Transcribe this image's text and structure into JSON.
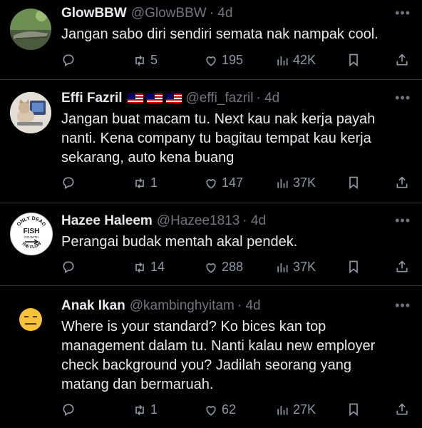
{
  "tweets": [
    {
      "name": "GlowBBW",
      "handle": "@GlowBBW",
      "time": "· 4d",
      "text": "Jangan sabo diri sendiri semata nak nampak cool.",
      "replies": "",
      "retweets": "5",
      "likes": "195",
      "views": "42K",
      "avatar_icon": "crocodile-photo-avatar"
    },
    {
      "name": "Effi Fazril",
      "handle": "@effi_fazril",
      "time": "· 4d",
      "flags": [
        "malaysia-flag",
        "malaysia-flag",
        "malaysia-flag"
      ],
      "text": "Jangan buat macam tu. Next kau nak kerja payah nanti. Kena company tu bagitau tempat kau kerja sekarang, auto kena buang",
      "replies": "",
      "retweets": "1",
      "likes": "147",
      "views": "37K",
      "avatar_icon": "cat-laptop-avatar"
    },
    {
      "name": "Hazee Haleem",
      "handle": "@Hazee1813",
      "time": "· 4d",
      "text": "Perangai budak mentah akal pendek.",
      "replies": "",
      "retweets": "14",
      "likes": "288",
      "views": "37K",
      "avatar_top": "ONLY DEAD",
      "avatar_mid": "FISH",
      "avatar_sub": "GO WITH",
      "avatar_bottom": "THE FLOW"
    },
    {
      "name": "Anak Ikan",
      "handle": "@kambinghyitam",
      "time": "· 4d",
      "text": "Where is your standard? Ko bices kan top management dalam tu. Nanti kalau new employer check background you? Jadilah seorang yang matang dan bermaruah.",
      "replies": "",
      "retweets": "1",
      "likes": "62",
      "views": "27K",
      "avatar_icon": "expressionless-emoji-avatar"
    }
  ],
  "colors": {
    "background": "#000000",
    "text": "#e7e9ea",
    "muted": "#71767b",
    "divider": "#2f3336"
  }
}
